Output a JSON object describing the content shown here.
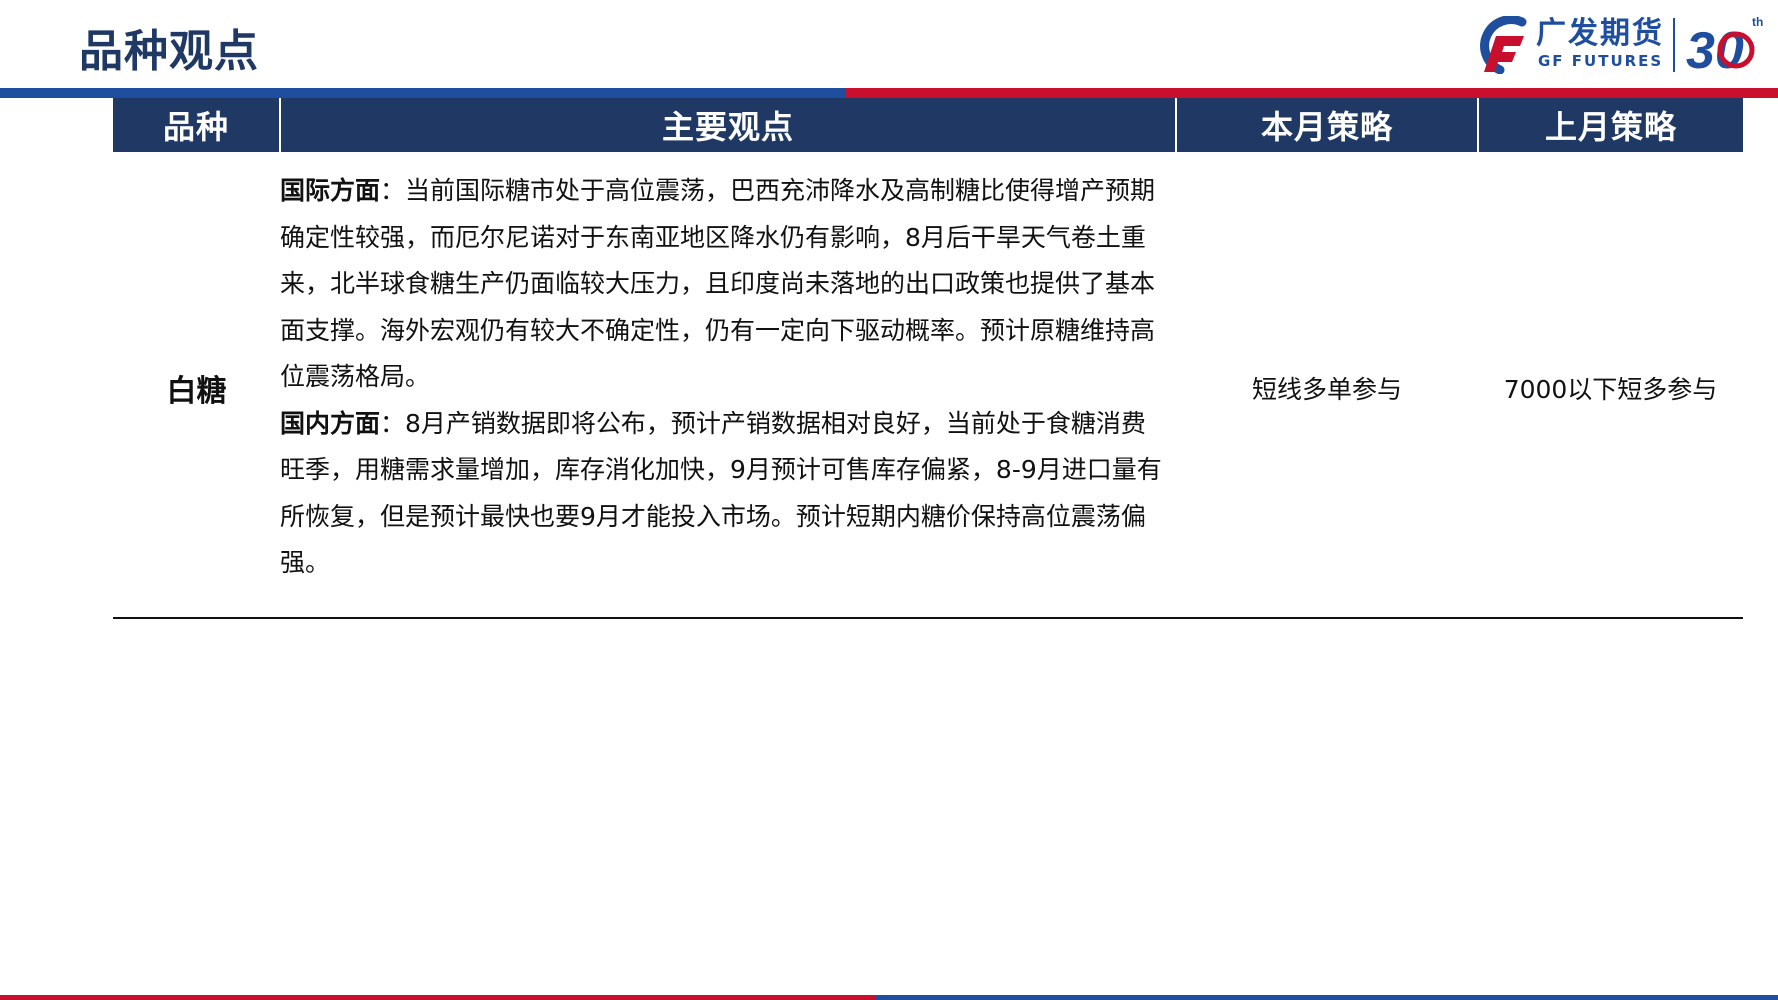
{
  "page": {
    "title": "品种观点"
  },
  "logo": {
    "name_cn": "广发期货",
    "name_en": "GF FUTURES",
    "anniversary_number": "30",
    "anniversary_suffix": "th"
  },
  "table": {
    "headers": [
      "品种",
      "主要观点",
      "本月策略",
      "上月策略"
    ],
    "rows": [
      {
        "variety": "白糖",
        "international": {
          "label": "国际方面",
          "text": "：当前国际糖市处于高位震荡，巴西充沛降水及高制糖比使得增产预期确定性较强，而厄尔尼诺对于东南亚地区降水仍有影响，8月后干旱天气卷土重来，北半球食糖生产仍面临较大压力，且印度尚未落地的出口政策也提供了基本面支撑。海外宏观仍有较大不确定性，仍有一定向下驱动概率。预计原糖维持高位震荡格局。"
        },
        "domestic": {
          "label": "国内方面",
          "text": "：8月产销数据即将公布，预计产销数据相对良好，当前处于食糖消费旺季，用糖需求量增加，库存消化加快，9月预计可售库存偏紧，8-9月进口量有所恢复，但是预计最快也要9月才能投入市场。预计短期内糖价保持高位震荡偏强。"
        },
        "this_month": "短线多单参与",
        "last_month": "7000以下短多参与"
      }
    ]
  },
  "colors": {
    "navy": "#1f3864",
    "blue": "#1f4e9e",
    "red": "#c8102e"
  }
}
